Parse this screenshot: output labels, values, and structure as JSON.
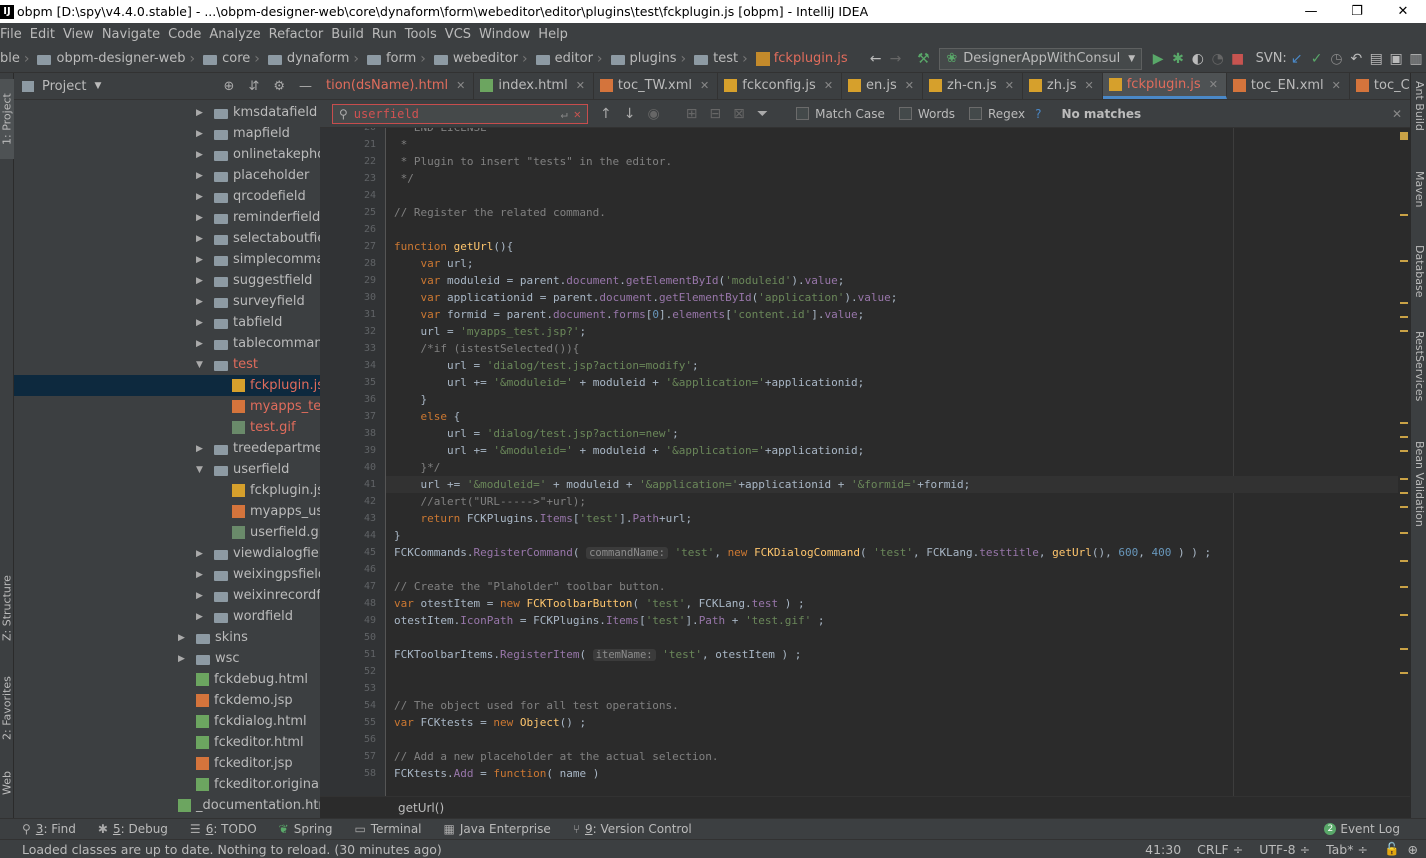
{
  "window": {
    "title": "obpm [D:\\spy\\v4.4.0.stable] - ...\\obpm-designer-web\\core\\dynaform\\form\\webeditor\\editor\\plugins\\test\\fckplugin.js [obpm] - IntelliJ IDEA",
    "minimize": "—",
    "maximize": "❐",
    "close": "✕"
  },
  "menu": [
    "File",
    "Edit",
    "View",
    "Navigate",
    "Code",
    "Analyze",
    "Refactor",
    "Build",
    "Run",
    "Tools",
    "VCS",
    "Window",
    "Help"
  ],
  "breadcrumbs": [
    "ble",
    "obpm-designer-web",
    "core",
    "dynaform",
    "form",
    "webeditor",
    "editor",
    "plugins",
    "test",
    "fckplugin.js"
  ],
  "run_config": "DesignerAppWithConsul",
  "svn_label": "SVN:",
  "project": {
    "header": "Project",
    "tree": [
      {
        "label": "kmsdatafield",
        "type": "folder",
        "depth": 2,
        "expanded": false
      },
      {
        "label": "mapfield",
        "type": "folder",
        "depth": 2,
        "expanded": false
      },
      {
        "label": "onlinetakephotofield",
        "type": "folder",
        "depth": 2,
        "expanded": false
      },
      {
        "label": "placeholder",
        "type": "folder",
        "depth": 2,
        "expanded": false
      },
      {
        "label": "qrcodefield",
        "type": "folder",
        "depth": 2,
        "expanded": false
      },
      {
        "label": "reminderfield",
        "type": "folder",
        "depth": 2,
        "expanded": false
      },
      {
        "label": "selectaboutfield",
        "type": "folder",
        "depth": 2,
        "expanded": false
      },
      {
        "label": "simplecommands",
        "type": "folder",
        "depth": 2,
        "expanded": false
      },
      {
        "label": "suggestfield",
        "type": "folder",
        "depth": 2,
        "expanded": false
      },
      {
        "label": "surveyfield",
        "type": "folder",
        "depth": 2,
        "expanded": false
      },
      {
        "label": "tabfield",
        "type": "folder",
        "depth": 2,
        "expanded": false
      },
      {
        "label": "tablecommands",
        "type": "folder",
        "depth": 2,
        "expanded": false
      },
      {
        "label": "test",
        "type": "folder",
        "depth": 2,
        "expanded": true,
        "status": "red"
      },
      {
        "label": "fckplugin.js",
        "type": "js",
        "depth": 3,
        "status": "red",
        "selected": true
      },
      {
        "label": "myapps_test.jsp",
        "type": "jsp",
        "depth": 3,
        "status": "red"
      },
      {
        "label": "test.gif",
        "type": "gif",
        "depth": 3,
        "status": "red"
      },
      {
        "label": "treedepartmentfield",
        "type": "folder",
        "depth": 2,
        "expanded": false
      },
      {
        "label": "userfield",
        "type": "folder",
        "depth": 2,
        "expanded": true
      },
      {
        "label": "fckplugin.js",
        "type": "js",
        "depth": 3
      },
      {
        "label": "myapps_userfield.",
        "type": "jsp",
        "depth": 3
      },
      {
        "label": "userfield.gif",
        "type": "gif",
        "depth": 3
      },
      {
        "label": "viewdialogfield",
        "type": "folder",
        "depth": 2,
        "expanded": false
      },
      {
        "label": "weixingpsfield",
        "type": "folder",
        "depth": 2,
        "expanded": false
      },
      {
        "label": "weixinrecordfield",
        "type": "folder",
        "depth": 2,
        "expanded": false
      },
      {
        "label": "wordfield",
        "type": "folder",
        "depth": 2,
        "expanded": false
      },
      {
        "label": "skins",
        "type": "folder",
        "depth": 1,
        "expanded": false
      },
      {
        "label": "wsc",
        "type": "folder",
        "depth": 1,
        "expanded": false
      },
      {
        "label": "fckdebug.html",
        "type": "html",
        "depth": 1
      },
      {
        "label": "fckdemo.jsp",
        "type": "jsp",
        "depth": 1
      },
      {
        "label": "fckdialog.html",
        "type": "html",
        "depth": 1
      },
      {
        "label": "fckeditor.html",
        "type": "html",
        "depth": 1
      },
      {
        "label": "fckeditor.jsp",
        "type": "jsp",
        "depth": 1
      },
      {
        "label": "fckeditor.original.html",
        "type": "html",
        "depth": 1
      },
      {
        "label": "_documentation.html",
        "type": "html",
        "depth": 0
      }
    ]
  },
  "tabs": [
    {
      "label": "tion(dsName).html",
      "active": false
    },
    {
      "label": "index.html",
      "active": false
    },
    {
      "label": "toc_TW.xml",
      "active": false
    },
    {
      "label": "fckconfig.js",
      "active": false
    },
    {
      "label": "en.js",
      "active": false
    },
    {
      "label": "zh-cn.js",
      "active": false
    },
    {
      "label": "zh.js",
      "active": false
    },
    {
      "label": "fckplugin.js",
      "active": true
    },
    {
      "label": "toc_EN.xml",
      "active": false
    },
    {
      "label": "toc_CN.xml",
      "active": false
    }
  ],
  "find": {
    "query": "userfield",
    "match_case": "Match Case",
    "words": "Words",
    "regex": "Regex",
    "help": "?",
    "result": "No matches"
  },
  "code": {
    "first_line": 20,
    "current_line": 41,
    "lines": [
      "   END LICENSE",
      " *",
      " * Plugin to insert \"tests\" in the editor.",
      " */",
      "",
      "// Register the related command.",
      "",
      "function getUrl(){",
      "    var url;",
      "    var moduleid = parent.document.getElementById('moduleid').value;",
      "    var applicationid = parent.document.getElementById('application').value;",
      "    var formid = parent.document.forms[0].elements['content.id'].value;",
      "    url = 'myapps_test.jsp?';",
      "    /*if (istestSelected()){",
      "        url = 'dialog/test.jsp?action=modify';",
      "        url += '&moduleid=' + moduleid + '&application='+applicationid;",
      "    }",
      "    else {",
      "        url = 'dialog/test.jsp?action=new';",
      "        url += '&moduleid=' + moduleid + '&application='+applicationid;",
      "    }*/",
      "    url += '&moduleid=' + moduleid + '&application='+applicationid + '&formid='+formid;",
      "    //alert(\"URL----->\"+url);",
      "    return FCKPlugins.Items['test'].Path+url;",
      "}",
      "FCKCommands.RegisterCommand( commandName: 'test', new FCKDialogCommand( 'test', FCKLang.testtitle, getUrl(), 600, 400 ) ) ;",
      "",
      "// Create the \"Plaholder\" toolbar button.",
      "var otestItem = new FCKToolbarButton( 'test', FCKLang.test ) ;",
      "otestItem.IconPath = FCKPlugins.Items['test'].Path + 'test.gif' ;",
      "",
      "FCKToolbarItems.RegisterItem( itemName: 'test', otestItem ) ;",
      "",
      "",
      "// The object used for all test operations.",
      "var FCKtests = new Object() ;",
      "",
      "// Add a new placeholder at the actual selection.",
      "FCKtests.Add = function( name )"
    ]
  },
  "editor_footer": "getUrl()",
  "tool_windows": [
    {
      "key": "3",
      "label": ": Find"
    },
    {
      "key": "5",
      "label": ": Debug"
    },
    {
      "key": "6",
      "label": ": TODO"
    },
    {
      "key": "",
      "label": "Spring"
    },
    {
      "key": "",
      "label": "Terminal"
    },
    {
      "key": "",
      "label": "Java Enterprise"
    },
    {
      "key": "9",
      "label": ": Version Control"
    }
  ],
  "event_log": "Event Log",
  "event_count": "2",
  "status": {
    "message": "Loaded classes are up to date. Nothing to reload. (30 minutes ago)",
    "position": "41:30",
    "line_sep": "CRLF ÷",
    "encoding": "UTF-8 ÷",
    "indent": "Tab* ÷"
  },
  "left_tool_tabs": [
    "1: Project",
    "Z: Structure",
    "2: Favorites",
    "Web"
  ],
  "right_tool_tabs": [
    "Ant Build",
    "Maven",
    "Database",
    "RestServices",
    "Bean Validation"
  ]
}
